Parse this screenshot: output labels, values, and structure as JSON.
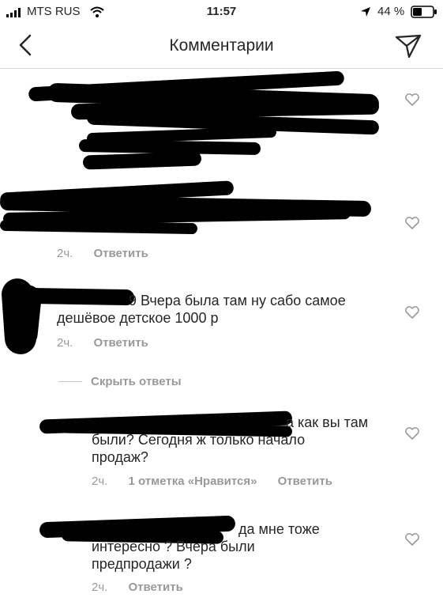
{
  "status_bar": {
    "carrier": "MTS RUS",
    "time": "11:57",
    "battery": "44 %"
  },
  "header": {
    "title": "Комментарии"
  },
  "comments": [
    {
      "text": "",
      "time": "",
      "reply": ""
    },
    {
      "text": "",
      "time": "2ч.",
      "reply": "Ответить"
    },
    {
      "text_line1": "9 Вчера была там ну сабо самое",
      "text_line2": "дешёвое детское 1000 р",
      "time": "2ч.",
      "reply": "Ответить"
    }
  ],
  "hide_replies": "Скрыть ответы",
  "replies": [
    {
      "text_line1": "а как вы там",
      "text_line2": "были? Сегодня ж только начало",
      "text_line3": "продаж?",
      "time": "2ч.",
      "likes": "1 отметка «Нравится»",
      "reply": "Ответить"
    },
    {
      "text_line1": "да мне тоже",
      "text_line2": "интересно ? Вчера были",
      "text_line3": "предпродажи ?",
      "time": "2ч.",
      "reply": "Ответить"
    }
  ]
}
